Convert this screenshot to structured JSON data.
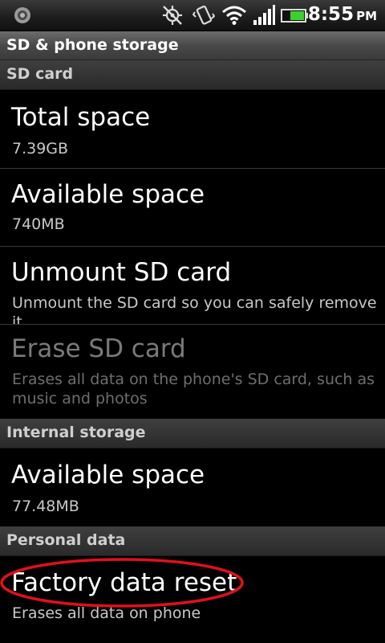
{
  "status_bar": {
    "time": "8:55",
    "ampm": "PM",
    "icons": [
      "notification-icon",
      "gps-icon",
      "vibrate-icon",
      "wifi-icon",
      "signal-icon",
      "battery-icon"
    ]
  },
  "title_bar": {
    "title": "SD & phone storage"
  },
  "sd_card": {
    "header": "SD card",
    "total_space": {
      "title": "Total space",
      "summary": "7.39GB"
    },
    "available_space": {
      "title": "Available space",
      "summary": "740MB"
    },
    "unmount": {
      "title": "Unmount SD card",
      "summary": "Unmount the SD card so you can safely remove it"
    },
    "erase": {
      "title": "Erase SD card",
      "summary": "Erases all data on the phone's SD card, such as music and photos"
    }
  },
  "internal_storage": {
    "header": "Internal storage",
    "available_space": {
      "title": "Available space",
      "summary": "77.48MB"
    }
  },
  "personal_data": {
    "header": "Personal data",
    "factory_reset": {
      "title": "Factory data reset",
      "summary": "Erases all data on phone"
    }
  },
  "colors": {
    "background": "#000000",
    "highlight_ellipse": "#e0101a",
    "battery_green": "#39d22e"
  }
}
